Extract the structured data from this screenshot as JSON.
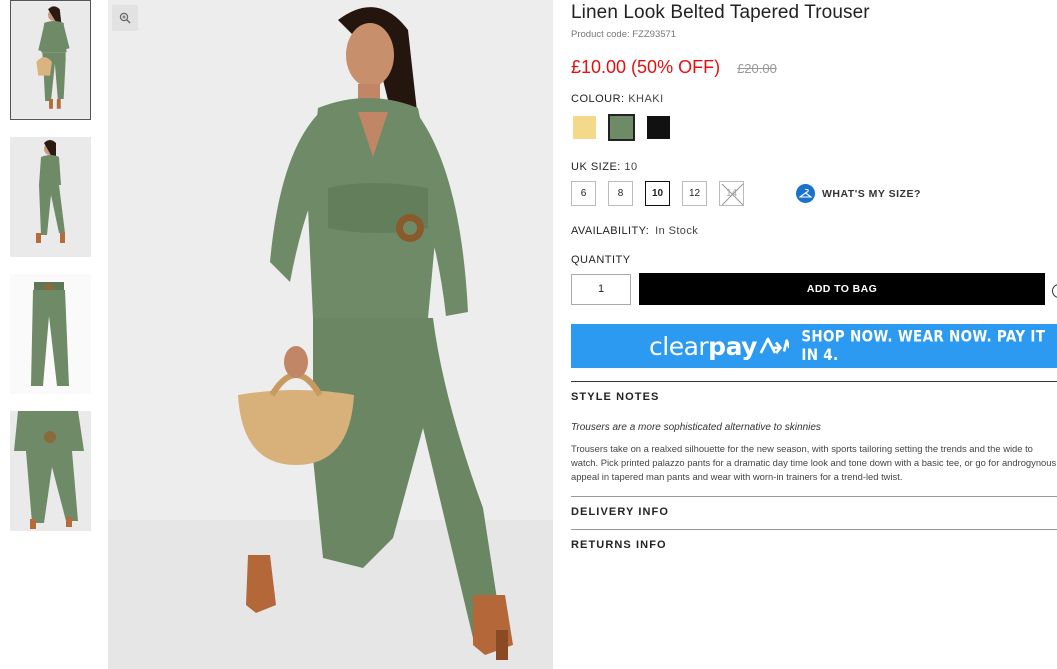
{
  "product": {
    "title": "Linen Look Belted Tapered Trouser",
    "code_label": "Product code: FZZ93571",
    "price": "£10.00 (50% OFF)",
    "was_price": "£20.00"
  },
  "colour": {
    "label": "COLOUR:",
    "value": "KHAKI",
    "swatches": [
      {
        "name": "Yellow",
        "hex": "#f5d98b"
      },
      {
        "name": "Khaki",
        "hex": "#6f8a66",
        "selected": true
      },
      {
        "name": "Black",
        "hex": "#111111"
      }
    ]
  },
  "size": {
    "label": "UK SIZE:",
    "value": "10",
    "options": [
      {
        "label": "6"
      },
      {
        "label": "8"
      },
      {
        "label": "10",
        "selected": true
      },
      {
        "label": "12"
      },
      {
        "label": "14",
        "disabled": true
      }
    ],
    "guide_label": "WHAT'S MY SIZE?"
  },
  "availability": {
    "label": "AVAILABILITY:",
    "value": "In Stock"
  },
  "quantity": {
    "label": "QUANTITY",
    "value": "1"
  },
  "add_to_bag": "ADD TO BAG",
  "clearpay": {
    "logo_text": "clear",
    "logo_bold": "pay",
    "tagline": "SHOP NOW. WEAR NOW. PAY IT IN 4."
  },
  "style_notes": {
    "heading": "STYLE NOTES",
    "subtitle": "Trousers are a more sophisticated alternative to skinnies",
    "body": "Trousers take on a realxed silhouette for the new season, with sports tailoring setting the trends and the wide to watch. Pick printed palazzo pants for a dramatic day time look and tone down with a basic tee, or go for androgynous appeal in tapered man pants and wear with worn-in trainers for a trend-led twist."
  },
  "delivery_info": "DELIVERY INFO",
  "returns_info": "RETURNS INFO",
  "icons": {
    "zoom": "zoom-icon",
    "hanger": "hanger-icon",
    "wishlist": "heart-icon"
  },
  "colors": {
    "sale_red": "#e4100f",
    "clearpay_blue": "#2b9af0",
    "khaki": "#6f8a66"
  }
}
